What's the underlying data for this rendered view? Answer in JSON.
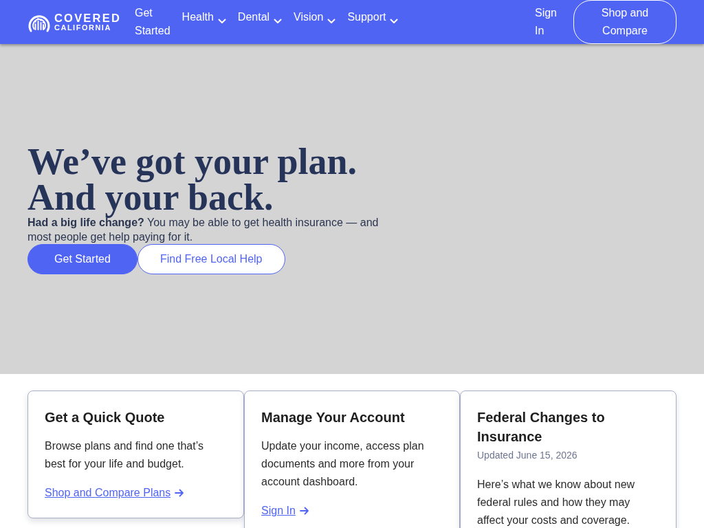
{
  "header": {
    "logo": {
      "lines": [
        "COVERED",
        "CALIFORNIA"
      ]
    },
    "nav": [
      {
        "label": "Get Started",
        "has_menu": false
      },
      {
        "label": "Health",
        "has_menu": true
      },
      {
        "label": "Dental",
        "has_menu": true
      },
      {
        "label": "Vision",
        "has_menu": true
      },
      {
        "label": "Support",
        "has_menu": true
      }
    ],
    "sign_in": "Sign In",
    "cta": "Shop and Compare"
  },
  "hero": {
    "heading_lines": [
      "We’ve got your plan.",
      "And your back."
    ],
    "text": "**Had a big life change?** You may be able to get health insurance — and most people get help paying for it.",
    "buttons": [
      {
        "label": "Get Started",
        "kind": "primary"
      },
      {
        "label": "Find Free Local Help",
        "kind": "secondary"
      }
    ]
  },
  "cards": [
    {
      "title": "Get a Quick Quote",
      "body": "Browse plans and find one that’s best for your life and budget.",
      "link": "Shop and Compare Plans"
    },
    {
      "title": "Manage Your Account",
      "body": "Update your income, access plan documents and more from your account dashboard.",
      "link": "Sign In"
    },
    {
      "title": "Federal Changes to Insurance",
      "updated": "Updated June 15, 2026",
      "body": "Here’s what we know about new federal rules and how they may affect your costs and coverage."
    }
  ]
}
